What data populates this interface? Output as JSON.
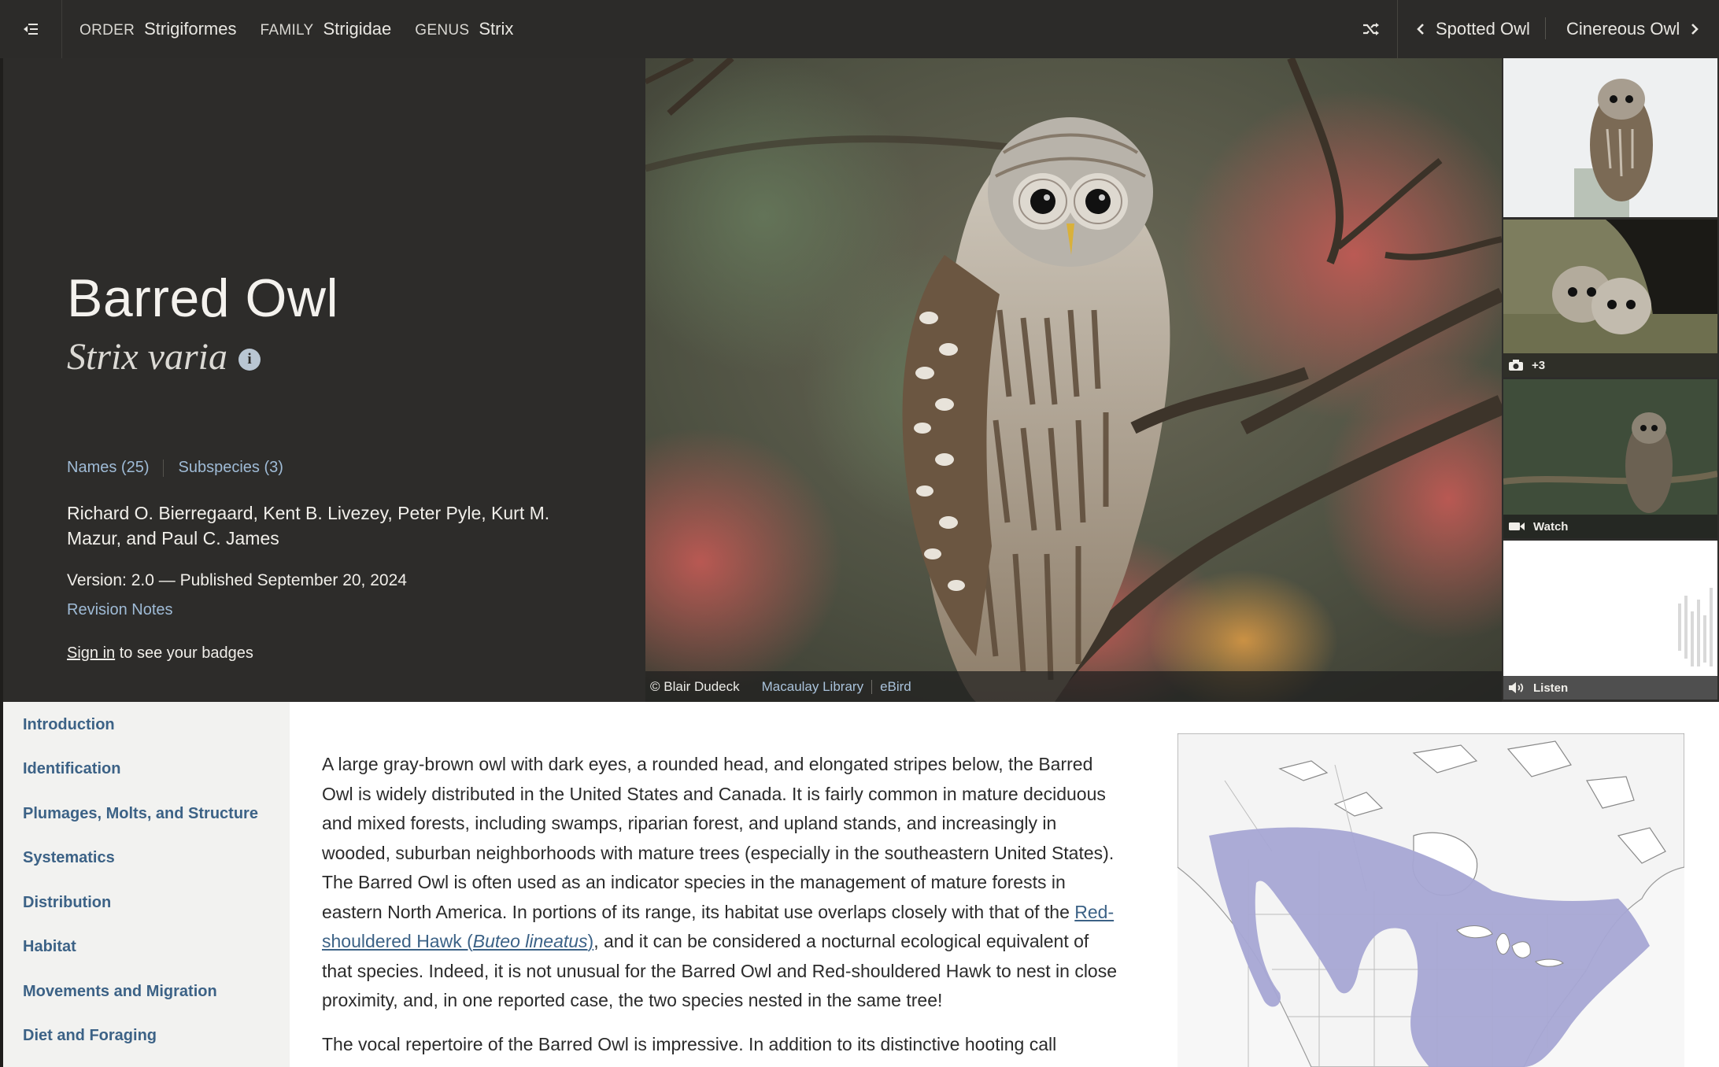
{
  "topbar": {
    "menu_icon": "collapse-menu-icon",
    "taxonomy": [
      {
        "key": "ORDER",
        "value": "Strigiformes"
      },
      {
        "key": "FAMILY",
        "value": "Strigidae"
      },
      {
        "key": "GENUS",
        "value": "Strix"
      }
    ],
    "shuffle_icon": "shuffle-icon",
    "prev_species": "Spotted Owl",
    "next_species": "Cinereous Owl"
  },
  "species": {
    "common_name": "Barred Owl",
    "scientific_name": "Strix varia",
    "names_link": "Names (25)",
    "subspecies_link": "Subspecies (3)",
    "authors": "Richard O. Bierregaard, Kent B. Livezey, Peter Pyle, Kurt M. Mazur, and Paul C. James",
    "version": "Version: 2.0 — Published September 20, 2024",
    "revision_notes": "Revision Notes",
    "signin_link": "Sign in",
    "signin_suffix": " to see your badges"
  },
  "photo": {
    "credit": "© Blair Dudeck",
    "library": "Macaulay Library",
    "ebird": "eBird"
  },
  "media_thumbs": {
    "photos_count": "+3",
    "watch": "Watch",
    "listen": "Listen"
  },
  "sidenav": {
    "items": [
      "Introduction",
      "Identification",
      "Plumages, Molts, and Structure",
      "Systematics",
      "Distribution",
      "Habitat",
      "Movements and Migration",
      "Diet and Foraging"
    ]
  },
  "content": {
    "p1_part1": "A large gray-brown owl with dark eyes, a rounded head, and elongated stripes below, the Barred Owl is widely distributed in the United States and Canada. It is fairly common in mature deciduous and mixed forests, including swamps, riparian forest, and upland stands, and increasingly in wooded, suburban neighborhoods with mature trees (especially in the southeastern United States). The Barred Owl is often used as an indicator species in the management of mature forests in eastern North America. In portions of its range, its habitat use overlaps closely with that of the ",
    "p1_link_name": "Red-shouldered Hawk (",
    "p1_link_sci": "Buteo lineatus",
    "p1_link_close": ")",
    "p1_part2": ", and it can be considered a nocturnal ecological equivalent of that species. Indeed, it is not unusual for the Barred Owl and Red-shouldered Hawk to nest in close proximity, and, in one reported case, the two species nested in the same tree!",
    "p2": "The vocal repertoire of the Barred Owl is impressive. In addition to its distinctive hooting call"
  },
  "colors": {
    "topbar_bg": "#2c2b29",
    "hero_bg": "#2d2c2a",
    "link_blue": "#3c6286",
    "range_purple": "#a7a6d4"
  }
}
